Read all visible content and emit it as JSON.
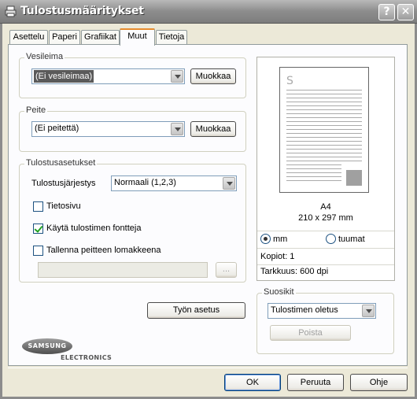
{
  "window": {
    "title": "Tulostusmääritykset",
    "help_glyph": "?",
    "close_glyph": "✕"
  },
  "tabs": [
    {
      "label": "Asettelu"
    },
    {
      "label": "Paperi"
    },
    {
      "label": "Grafiikat"
    },
    {
      "label": "Muut",
      "active": true
    },
    {
      "label": "Tietoja"
    }
  ],
  "watermark": {
    "group_label": "Vesileima",
    "selected": "(Ei vesileimaa)",
    "edit_label": "Muokkaa"
  },
  "overlay": {
    "group_label": "Peite",
    "selected": "(Ei peitettä)",
    "edit_label": "Muokkaa"
  },
  "output": {
    "group_label": "Tulostusasetukset",
    "order_label": "Tulostusjärjestys",
    "order_value": "Normaali (1,2,3)",
    "checkboxes": [
      {
        "label": "Tietosivu",
        "checked": false
      },
      {
        "label": "Käytä tulostimen fontteja",
        "checked": true
      },
      {
        "label": "Tallenna peitteen lomakkeena",
        "checked": false
      }
    ],
    "browse_label": "..."
  },
  "preview": {
    "paper": "A4",
    "dimensions": "210 x 297 mm",
    "page_logo": "S",
    "unit_mm": "mm",
    "unit_inch": "tuumat",
    "selected_unit": "mm",
    "copies": "Kopiot: 1",
    "resolution": "Tarkkuus: 600 dpi"
  },
  "favorites": {
    "group_label": "Suosikit",
    "selected": "Tulostimen oletus",
    "delete_label": "Poista"
  },
  "job_options_label": "Työn asetus",
  "logo": {
    "brand": "SAMSUNG",
    "sub": "ELECTRONICS"
  },
  "footer": {
    "ok": "OK",
    "cancel": "Peruuta",
    "help": "Ohje"
  },
  "colors": {
    "title_bar": "#8c8c8c",
    "tab_highlight": "#e68b2c",
    "selection": "#5a5a5a",
    "check": "#21a121"
  }
}
